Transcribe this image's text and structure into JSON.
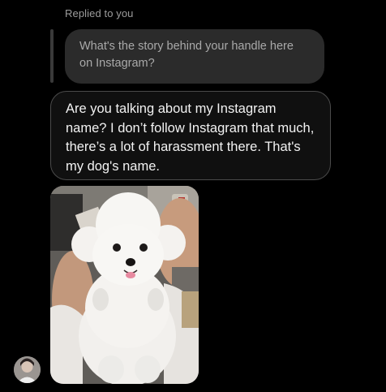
{
  "thread": {
    "replied_label": "Replied to you",
    "quoted_message": "What's the story behind your handle here on Instagram?",
    "reply_message": "Are you talking about my Instagram name? I don’t follow Instagram that much, there’s a lot of harassment there. That's my dog's name."
  },
  "photo": {
    "subject_icon": "dog-photo"
  },
  "sender": {
    "avatar_icon": "user-avatar"
  },
  "colors": {
    "background": "#000000",
    "quoted_bubble": "#2b2b2b",
    "reply_bubble_border": "#4b4b4b",
    "secondary_text": "#9c9c9c"
  }
}
